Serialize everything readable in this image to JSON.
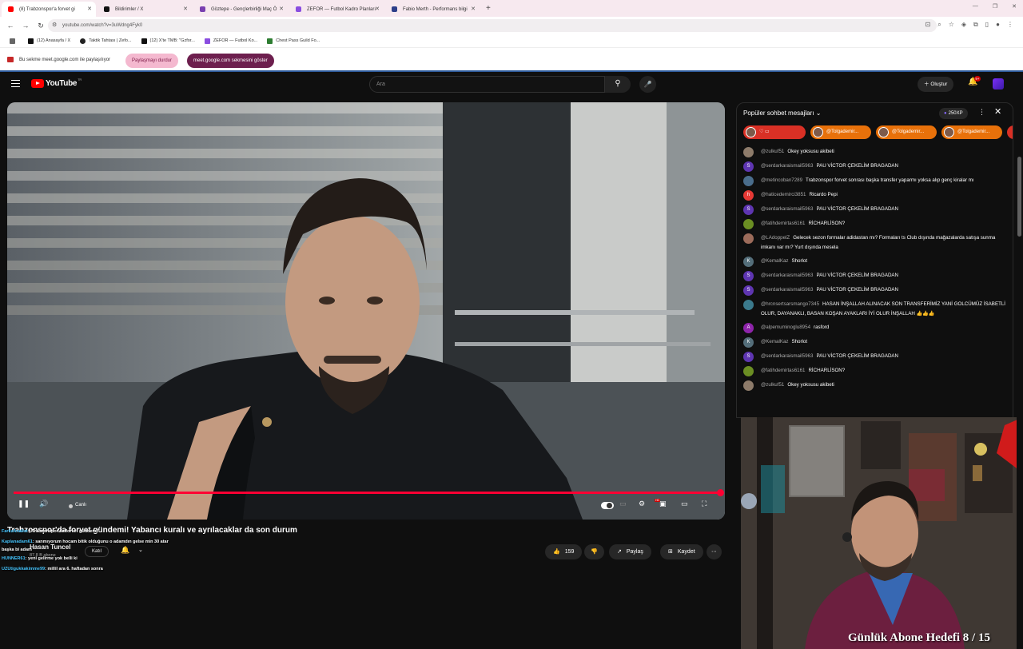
{
  "browser": {
    "tabs": [
      {
        "title": "(8) Trabzonspor'a forvet gi",
        "color": "#ff0000"
      },
      {
        "title": "Bildirimler / X",
        "color": "#111111"
      },
      {
        "title": "Göztepe - Gençlerbirliği Maç Ö",
        "color": "#7a3fb0"
      },
      {
        "title": "ZEFOR — Futbol Kadro Planları",
        "color": "#8a4de0"
      },
      {
        "title": "Fabio Merth - Performans bilgi",
        "color": "#2d3f8a"
      }
    ],
    "url": "youtube.com/watch?v=3uWdng4Fyk0",
    "bookmarks": [
      "(12) Anasayfa / X",
      "Taktik Tahtası | Zefo...",
      "(12) X'te TMB: \"Gzfor...",
      "ZEFOR — Futbol Ko...",
      "Chest Pass Guild Fo..."
    ]
  },
  "share_bar": {
    "text": "Bu sekme meet.google.com ile paylaşılıyor",
    "stop_label": "Paylaşmayı durdur",
    "show_label": "meet.google.com sekmesini göster"
  },
  "youtube": {
    "logo_text": "YouTube",
    "region": "TR",
    "search_placeholder": "Ara",
    "create_label": "Oluştur",
    "notification_count": "9+",
    "live_label": "Canlı",
    "video_title": "Trabzonspor'da forvet gündemi! Yabancı kuralı ve ayrılacaklar da son durum",
    "channel_name": "Hasan Tuncel",
    "channel_subs": "87,8 B abone",
    "join_label": "Katıl",
    "like_count": "159",
    "share_label": "Paylaş",
    "save_label": "Kaydet"
  },
  "overlay_comments": [
    {
      "user": "FarkzAnalist",
      "text": ":) Trabzonspor'da forvet gündemi!"
    },
    {
      "user": "Kaplanadam61",
      "text": ": sanmıyorum hocam bitik olduğunu o adamdın gelse min 30 atar"
    },
    {
      "user": "",
      "text": "başka bi adam"
    },
    {
      "user": "HUNNER61",
      "text": ": yeni gelirme yok belli ki"
    },
    {
      "user": "UZUtigukkakimme99",
      "text": ": millil ara 6. haftadan sonra"
    }
  ],
  "chat": {
    "header": "Popüler sohbet mesajları",
    "xp_label": "250XP",
    "pinned": [
      "",
      "@Tolgademir...",
      "@Tolgademir...",
      "@Tolgademir..."
    ],
    "messages": [
      {
        "user": "@zulkuf51",
        "text": "Okey yoksusu akibeti",
        "avatar": "",
        "color": "#8d7b6a"
      },
      {
        "user": "@serdarkaraismail5963",
        "text": "PAU VİCTOR ÇEKELİM BRAGADAN",
        "avatar": "S",
        "color": "#5e35b1"
      },
      {
        "user": "@metincoban7289",
        "text": "Trabzonspor forvet sonrası başka transfer yaparmı yoksa alıp genç kiralar mı",
        "avatar": "",
        "color": "#4a6d8c"
      },
      {
        "user": "@haticedemirci3851",
        "text": "Ricardo Pepi",
        "avatar": "h",
        "color": "#e53935"
      },
      {
        "user": "@serdarkaraismail5963",
        "text": "PAU VİCTOR ÇEKELİM BRAGADAN",
        "avatar": "S",
        "color": "#5e35b1"
      },
      {
        "user": "@fatihdemirtas6161",
        "text": "RİCHARLİSON?",
        "avatar": "",
        "color": "#6b8e23"
      },
      {
        "user": "@LAdoppelZ",
        "text": "Gelecek sezon formalar adidastan mı? Formaları ts Club dışında mağazalarda satışa sunma imkanı var mı? Yurt dışında mesela",
        "avatar": "",
        "color": "#9c6b5a"
      },
      {
        "user": "@KemalKaz",
        "text": "Shorlot",
        "avatar": "K",
        "color": "#546e7a"
      },
      {
        "user": "@serdarkaraismail5963",
        "text": "PAU VİCTOR ÇEKELİM BRAGADAN",
        "avatar": "S",
        "color": "#5e35b1"
      },
      {
        "user": "@serdarkaraismail5963",
        "text": "PAU VİCTOR ÇEKELİM BRAGADAN",
        "avatar": "S",
        "color": "#5e35b1"
      },
      {
        "user": "@hrcnsertsarsmango7345",
        "text": "HASAN İNŞALLAH ALINACAK SON TRANSFERİMİZ YANİ GOLCÜMÜZ İSABETLİ OLUR, DAYANAKLI, BASAN KOŞAN AYAKLARI İYİ OLUR İNŞALLAH 👍👍👍",
        "avatar": "",
        "color": "#3b7a8c"
      },
      {
        "user": "@alpemuminoglu8954",
        "text": "rasford",
        "avatar": "A",
        "color": "#8e24aa"
      },
      {
        "user": "@KemalKaz",
        "text": "Shorlot",
        "avatar": "K",
        "color": "#546e7a"
      },
      {
        "user": "@serdarkaraismail5963",
        "text": "PAU VİCTOR ÇEKELİM BRAGADAN",
        "avatar": "S",
        "color": "#5e35b1"
      },
      {
        "user": "@fatihdemirtas6161",
        "text": "RİCHARLİSON?",
        "avatar": "",
        "color": "#6b8e23"
      },
      {
        "user": "@zulkuf51",
        "text": "Okey yoksusu akibeti",
        "avatar": "",
        "color": "#8d7b6a"
      }
    ]
  },
  "webcam": {
    "caption": "Günlük Abone Hedefi 8 / 15"
  },
  "colors": {
    "accent": "#ff0033",
    "bg": "#0f0f0f",
    "share_pink": "#f4b8cf",
    "share_plum": "#6d1f4e"
  }
}
